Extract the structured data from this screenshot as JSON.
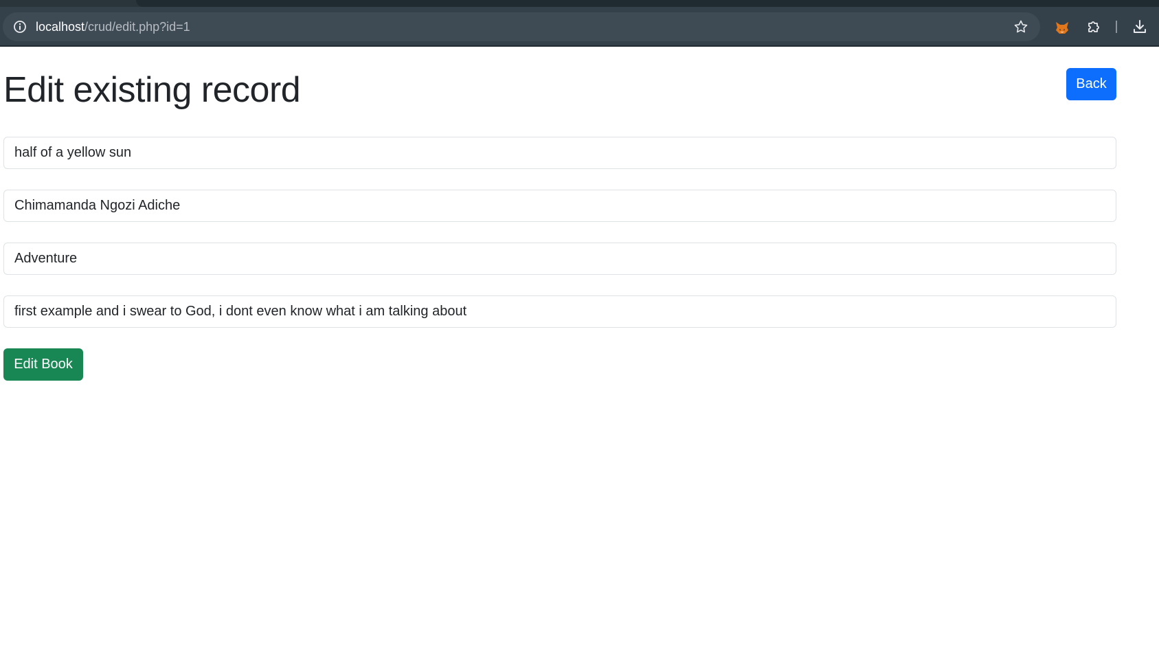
{
  "browser": {
    "url_host": "localhost",
    "url_path": "/crud/edit.php?id=1",
    "icons": [
      "info-icon",
      "star-icon",
      "fox-extension-icon",
      "extensions-puzzle-icon",
      "download-icon"
    ]
  },
  "page": {
    "title": "Edit existing record",
    "back_label": "Back",
    "fields": {
      "title_value": "half of a yellow sun",
      "author_value": "Chimamanda Ngozi Adiche",
      "genre_value": "Adventure",
      "description_value": "first example and i swear to God, i dont even know what i am talking about"
    },
    "submit_label": "Edit Book"
  },
  "colors": {
    "primary": "#0d6efd",
    "success": "#198754",
    "browser_chrome": "#35414a"
  }
}
